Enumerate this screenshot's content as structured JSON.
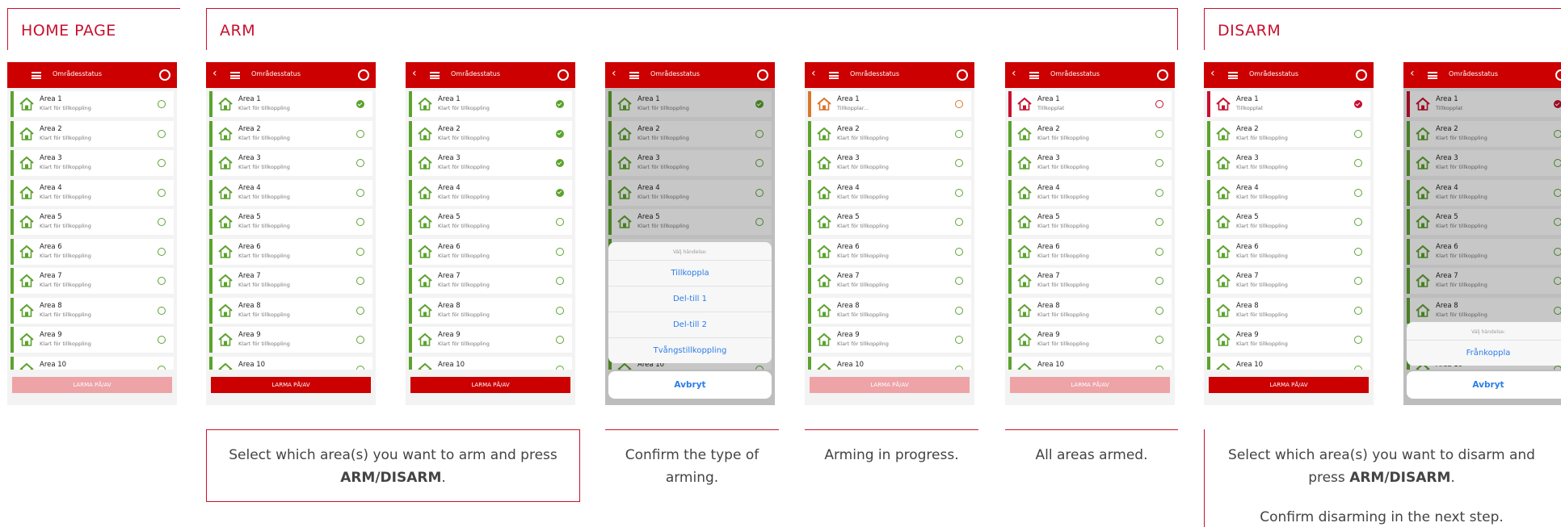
{
  "sections": {
    "home": "HOME PAGE",
    "arm": "ARM",
    "disarm": "DISARM"
  },
  "app": {
    "back": "‹",
    "title": "Områdesstatus",
    "footer": "LARMA PÅ/AV",
    "sub_ready": "Klart för tillkoppling",
    "sub_arming": "Tillkopplar...",
    "sub_armed": "Tillkopplat",
    "areas": [
      "Area 1",
      "Area 2",
      "Area 3",
      "Area 4",
      "Area 5",
      "Area 6",
      "Area 7",
      "Area 8",
      "Area 9",
      "Area 10"
    ]
  },
  "sheet_arm": {
    "heading": "Välj händelse:",
    "options": [
      "Tillkoppla",
      "Del-till 1",
      "Del-till 2",
      "Tvångstillkoppling"
    ],
    "cancel": "Avbryt"
  },
  "sheet_disarm": {
    "heading": "Välj händelse:",
    "options": [
      "Frånkoppla"
    ],
    "cancel": "Avbryt"
  },
  "captions": {
    "select_pre": "Select which area(s) you want to arm and press",
    "select_bold": "ARM/DISARM",
    "select_post": ".",
    "confirm": "Confirm the type of arming.",
    "progress": "Arming in progress.",
    "armed": "All areas armed.",
    "dis_pre": "Select which area(s) you want to disarm and press",
    "dis_bold": "ARM/DISARM",
    "dis_post": ".",
    "dis_next": "Confirm disarming in the next step."
  },
  "colors": {
    "brand_red": "#cc0000",
    "ready_green": "#5ca32e",
    "arming_orange": "#d9782d",
    "armed_red": "#c8102e",
    "link_blue": "#2b7de9"
  }
}
